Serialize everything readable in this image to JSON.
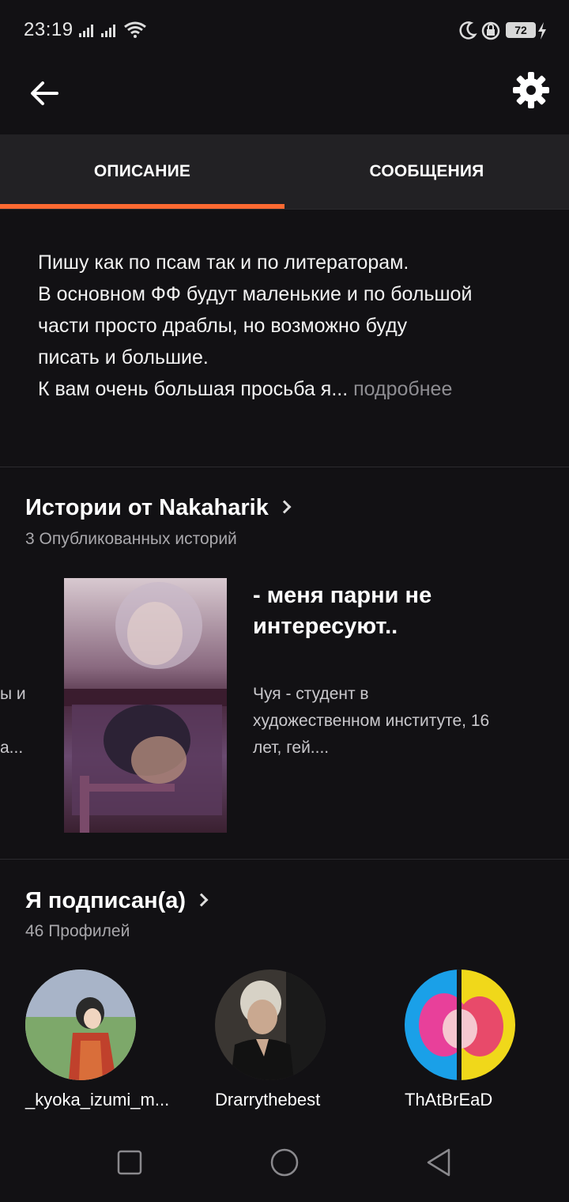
{
  "status_bar": {
    "time": "23:19",
    "battery": "72",
    "icons": [
      "signal-icon",
      "signal-icon",
      "wifi-icon",
      "moon-icon",
      "lock-rotation-icon",
      "charging-icon"
    ]
  },
  "top_bar": {
    "back_icon": "arrow-left-icon",
    "settings_icon": "gear-icon"
  },
  "tabs": [
    {
      "label": "ОПИСАНИЕ",
      "active": true
    },
    {
      "label": "СООБЩЕНИЯ",
      "active": false
    }
  ],
  "accent_color": "#ff6a32",
  "description": {
    "lines": [
      "Пишу как по псам так и по литераторам.",
      "В основном ФФ будут маленькие и по большой",
      "части просто драблы, но возможно буду",
      "писать и большие.",
      "К вам очень большая просьба я..."
    ],
    "more_label": " подробнее"
  },
  "stories": {
    "title": "Истории от Nakaharik",
    "subtitle": "3 Опубликованных историй",
    "peek_lines": [
      "ы и",
      "а..."
    ],
    "item": {
      "title_lines": [
        "- меня парни не",
        "интересуют.."
      ],
      "desc_lines": [
        "Чуя - студент в",
        "художественном институте, 16",
        "лет, гей...."
      ]
    }
  },
  "following": {
    "title": "Я подписан(а)",
    "subtitle": "46 Профилей",
    "profiles": [
      {
        "name": "_kyoka_izumi_m..."
      },
      {
        "name": "Drarrythebest"
      },
      {
        "name": "ThAtBrEaD"
      }
    ]
  },
  "nav_bar": {
    "icons": [
      "recent-apps-icon",
      "home-icon",
      "back-triangle-icon"
    ]
  }
}
